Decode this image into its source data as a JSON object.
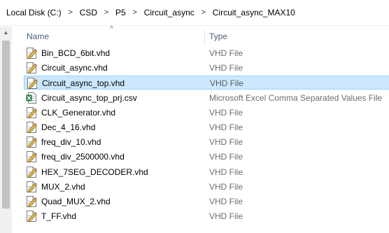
{
  "breadcrumb": {
    "items": [
      "Local Disk (C:)",
      "CSD",
      "P5",
      "Circuit_async",
      "Circuit_async_MAX10"
    ],
    "separator": ">"
  },
  "columns": {
    "name": "Name",
    "type": "Type",
    "sort_indicator": "^"
  },
  "scrollbar": {
    "up_arrow": "▲"
  },
  "files": [
    {
      "name": "Bin_BCD_6bit.vhd",
      "type": "VHD File",
      "icon": "vhd-file-icon"
    },
    {
      "name": "Circuit_async.vhd",
      "type": "VHD File",
      "icon": "vhd-file-icon"
    },
    {
      "name": "Circuit_async_top.vhd",
      "type": "VHD File",
      "icon": "vhd-file-icon",
      "selected": true
    },
    {
      "name": "Circuit_async_top_prj.csv",
      "type": "Microsoft Excel Comma Separated Values File",
      "icon": "excel-csv-icon"
    },
    {
      "name": "CLK_Generator.vhd",
      "type": "VHD File",
      "icon": "vhd-file-icon"
    },
    {
      "name": "Dec_4_16.vhd",
      "type": "VHD File",
      "icon": "vhd-file-icon"
    },
    {
      "name": "freq_div_10.vhd",
      "type": "VHD File",
      "icon": "vhd-file-icon"
    },
    {
      "name": "freq_div_2500000.vhd",
      "type": "VHD File",
      "icon": "vhd-file-icon"
    },
    {
      "name": "HEX_7SEG_DECODER.vhd",
      "type": "VHD File",
      "icon": "vhd-file-icon"
    },
    {
      "name": "MUX_2.vhd",
      "type": "VHD File",
      "icon": "vhd-file-icon"
    },
    {
      "name": "Quad_MUX_2.vhd",
      "type": "VHD File",
      "icon": "vhd-file-icon"
    },
    {
      "name": "T_FF.vhd",
      "type": "VHD File",
      "icon": "vhd-file-icon"
    }
  ]
}
